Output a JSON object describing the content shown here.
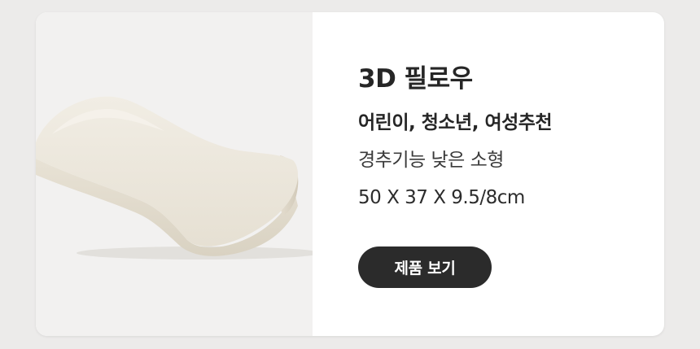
{
  "product": {
    "title": "3D 필로우",
    "recommended_for": "어린이, 청소년, 여성추천",
    "description": "경추기능 낮은 소형",
    "dimensions": "50 X 37 X 9.5/8cm",
    "cta_label": "제품 보기"
  },
  "image": {
    "subject": "pillow-image"
  },
  "colors": {
    "page_background": "#ecebea",
    "card_background": "#ffffff",
    "image_background": "#f2f1f0",
    "button_background": "#2b2b2b",
    "button_text": "#ffffff",
    "title_text": "#262626"
  }
}
